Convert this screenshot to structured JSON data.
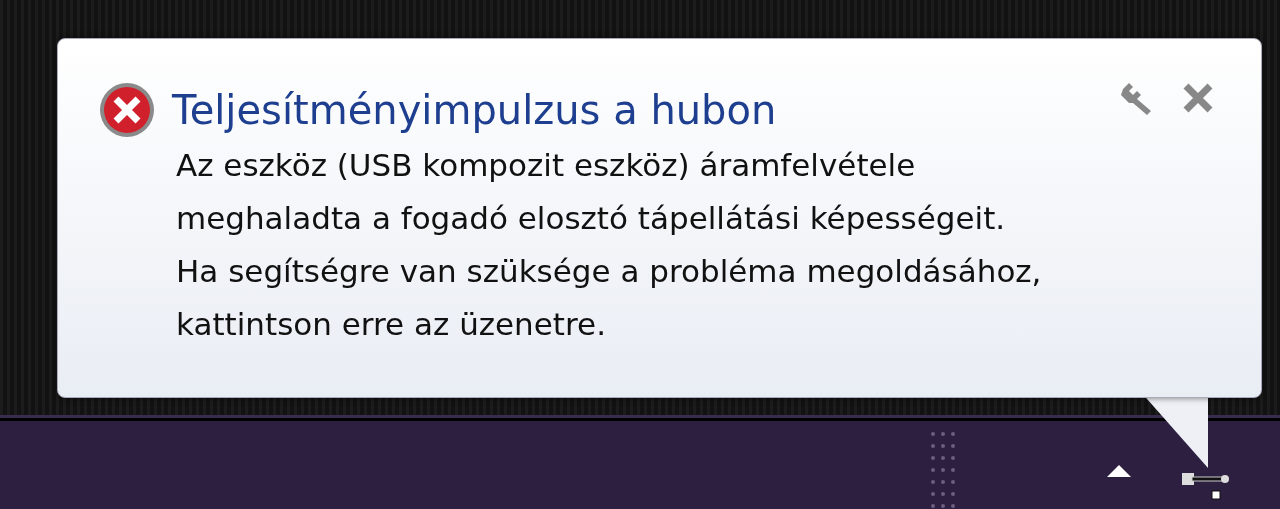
{
  "notification": {
    "kind": "error",
    "title": "Teljesítményimpulzus a hubon",
    "body_lines": [
      "Az eszköz (USB kompozit eszköz) áramfelvétele",
      "meghaladta a fogadó elosztó tápellátási képességeit.",
      "Ha segítségre van szüksége a probléma megoldásához,",
      "kattintson erre az üzenetre."
    ]
  }
}
